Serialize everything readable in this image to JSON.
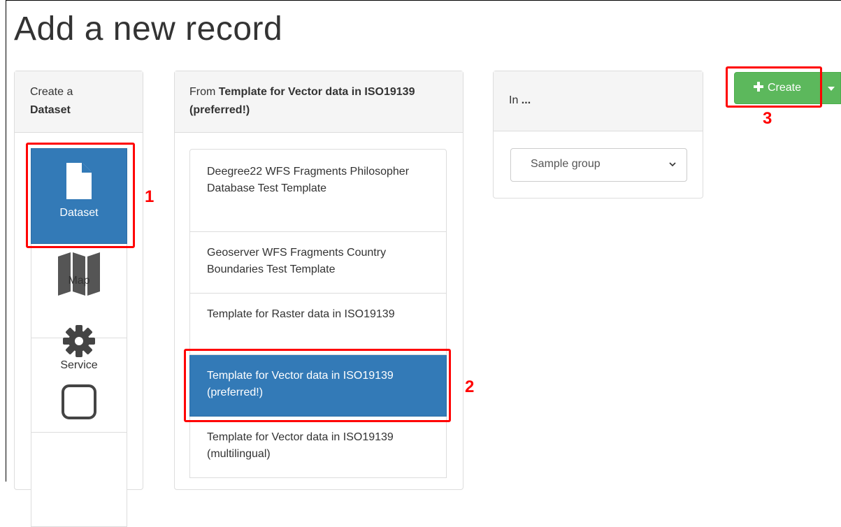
{
  "page": {
    "title": "Add a new record"
  },
  "type_panel": {
    "heading_prefix": "Create a",
    "heading_value": "Dataset",
    "items": [
      {
        "label": "Dataset",
        "icon": "file-icon",
        "active": true
      },
      {
        "label": "Map",
        "icon": "map-icon"
      },
      {
        "label": "Service",
        "icon": "gear-icon"
      },
      {
        "label": "",
        "icon": "square-icon"
      }
    ]
  },
  "template_panel": {
    "heading_prefix": "From",
    "heading_value": "Template for Vector data in ISO19139 (preferred!)",
    "items": [
      {
        "label": "Deegree22 WFS Fragments Philosopher Database Test Template"
      },
      {
        "label": "Geoserver WFS Fragments Country Boundaries Test Template"
      },
      {
        "label": "Template for Raster data in ISO19139"
      },
      {
        "label": "Template for Vector data in ISO19139 (preferred!)",
        "active": true
      },
      {
        "label": "Template for Vector data in ISO19139 (multilingual)"
      }
    ]
  },
  "group_panel": {
    "heading_prefix": "In",
    "heading_value": "...",
    "select_value": "Sample group"
  },
  "create_button": {
    "label": "Create"
  },
  "annotations": {
    "one": "1",
    "two": "2",
    "three": "3"
  },
  "colors": {
    "primary": "#337ab7",
    "success": "#5cb85c",
    "annotation": "#ff0000"
  }
}
